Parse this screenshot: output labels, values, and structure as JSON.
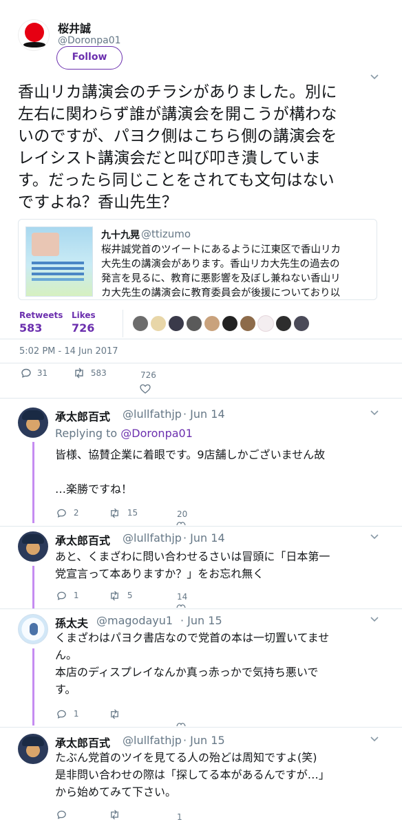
{
  "tweet": {
    "display_name": "桜井誠",
    "username": "@Doronpa01",
    "follow_label": "Follow",
    "text": "香山リカ講演会のチラシがありました。別に\n左右に関わらず誰が講演会を開こうが構わな\nいのですが、パヨク側はこちら側の講演会を\nレイシスト講演会だと叫び叩き潰していま\nす。だったら同じことをされても文句はない\nですよね？香山先生？",
    "quote": {
      "name": "九十九晃",
      "handle": "@ttizumo",
      "text": "桜井誠党首のツイートにあるように江東区で香山リカ\n大先生の講演会があります。香山リカ大先生の過去の\n発言を見るに、教育に悪影響を及ぼし兼ねない香山リ\nカ大先生の講演会に教育委員会が後援についており以"
    },
    "stats": {
      "retweets_label": "Retweets",
      "retweets": "583",
      "likes_label": "Likes",
      "likes": "726"
    },
    "timestamp": "5:02 PM - 14 Jun 2017",
    "actions": {
      "replies": "31",
      "retweets": "583",
      "likes": "726"
    },
    "accent_color": "#6b2fae"
  },
  "replies": [
    {
      "display_name": "承太郎百式",
      "handle": "@lullfathjp",
      "date": "Jun 14",
      "replying_prefix": "Replying to",
      "replying_to": "@Doronpa01",
      "text": "皆様、協賛企業に着眼です。9店舗しかございません故\n\n…楽勝ですね！",
      "actions": {
        "replies": "2",
        "retweets": "15",
        "likes": "20"
      }
    },
    {
      "display_name": "承太郎百式",
      "handle": "@lullfathjp",
      "date": "Jun 14",
      "text": "あと、くまざわに問い合わせるさいは冒頭に「日本第一\n党宣言って本ありますか？」をお忘れ無く",
      "actions": {
        "replies": "1",
        "retweets": "5",
        "likes": "14"
      }
    },
    {
      "display_name": "孫太夫",
      "handle": "@magodayu1",
      "date": "Jun 15",
      "text": "くまざわはパヨク書店なので党首の本は一切置いてませ\nん。\n本店のディスプレイなんか真っ赤っかで気持ち悪いで\nす。",
      "actions": {
        "replies": "1",
        "retweets": "",
        "likes": ""
      }
    },
    {
      "display_name": "承太郎百式",
      "handle": "@lullfathjp",
      "date": "Jun 15",
      "text": "たぶん党首のツイを見てる人の殆どは周知ですよ(笑)\n是非問い合わせの際は「探してる本があるんですが…」\nから始めてみて下さい。",
      "actions": {
        "replies": "",
        "retweets": "",
        "likes": "1"
      }
    }
  ]
}
